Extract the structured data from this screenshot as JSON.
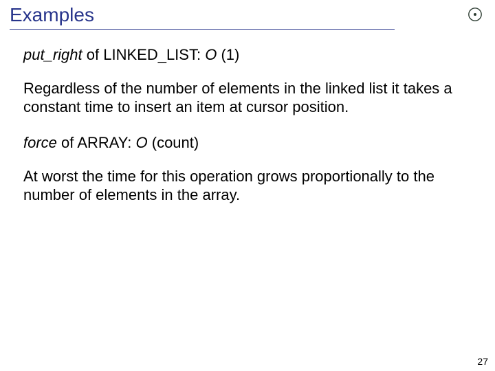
{
  "title": "Examples",
  "examples": [
    {
      "op": "put_right",
      "of_word": "of",
      "collection": "LINKED_LIST",
      "bigO_letter": "O",
      "bigO_arg": "(1)",
      "explanation": "Regardless of the number of elements in the linked list it takes a constant time to insert an item at cursor position."
    },
    {
      "op": "force",
      "of_word": "of",
      "collection": "ARRAY",
      "bigO_letter": "O",
      "bigO_arg": "(count)",
      "explanation": "At worst the time for this operation grows proportionally to the number of elements in the array."
    }
  ],
  "page_number": "27"
}
